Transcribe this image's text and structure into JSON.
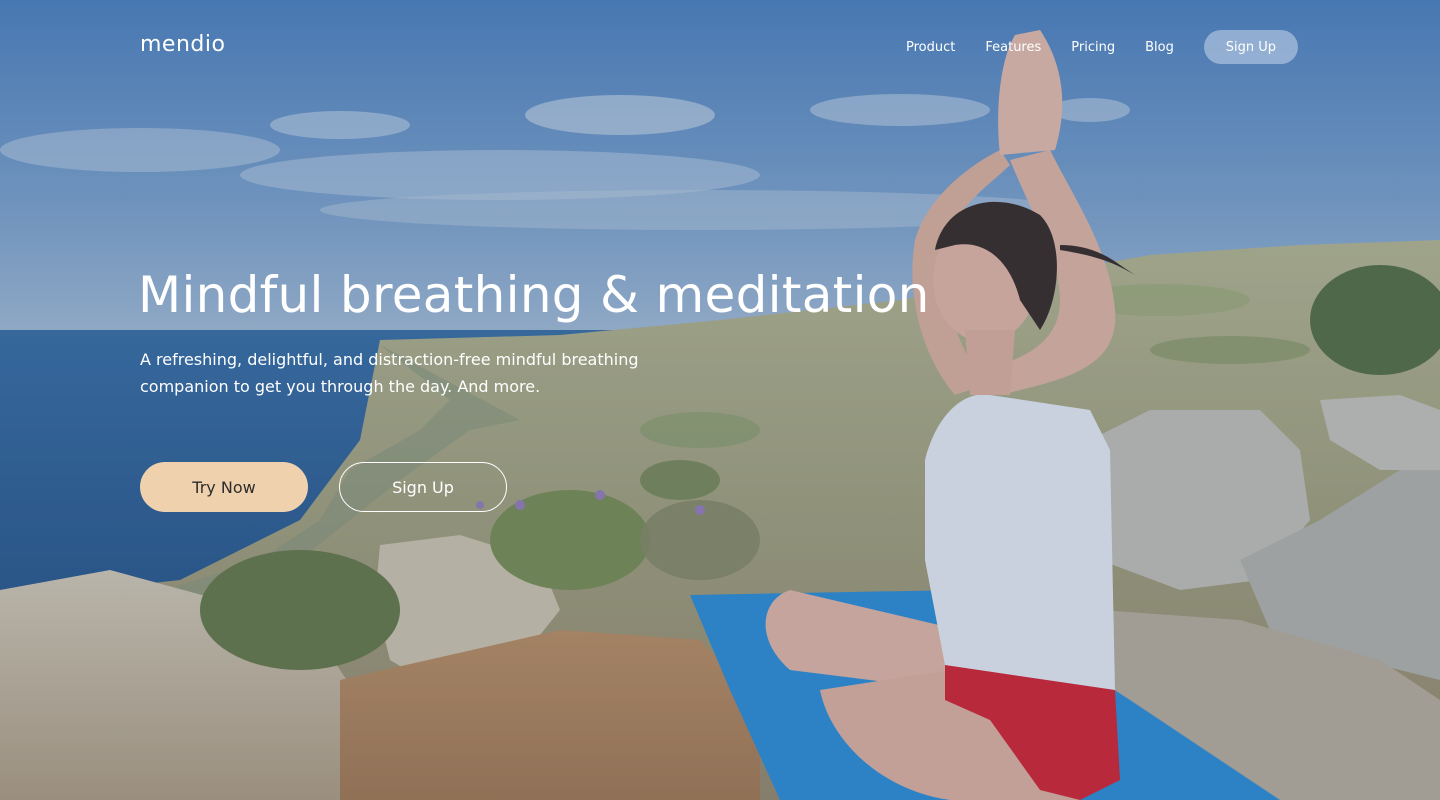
{
  "brand": {
    "logo": "mendio"
  },
  "nav": {
    "links": [
      "Product",
      "Features",
      "Pricing",
      "Blog"
    ],
    "signup_label": "Sign Up"
  },
  "hero": {
    "headline": "Mindful breathing & meditation",
    "subtext": "A refreshing, delightful, and distraction-free mindful breathing companion to get you through the day. And more.",
    "primary_cta": "Try Now",
    "secondary_cta": "Sign Up",
    "background_image": "woman-meditating-on-cliff-by-sea"
  },
  "colors": {
    "primary_button": "#efd2ad",
    "primary_button_text": "#2c2c2c",
    "text": "#ffffff",
    "sky": "#4f80b8",
    "sea": "#2f5e93"
  }
}
